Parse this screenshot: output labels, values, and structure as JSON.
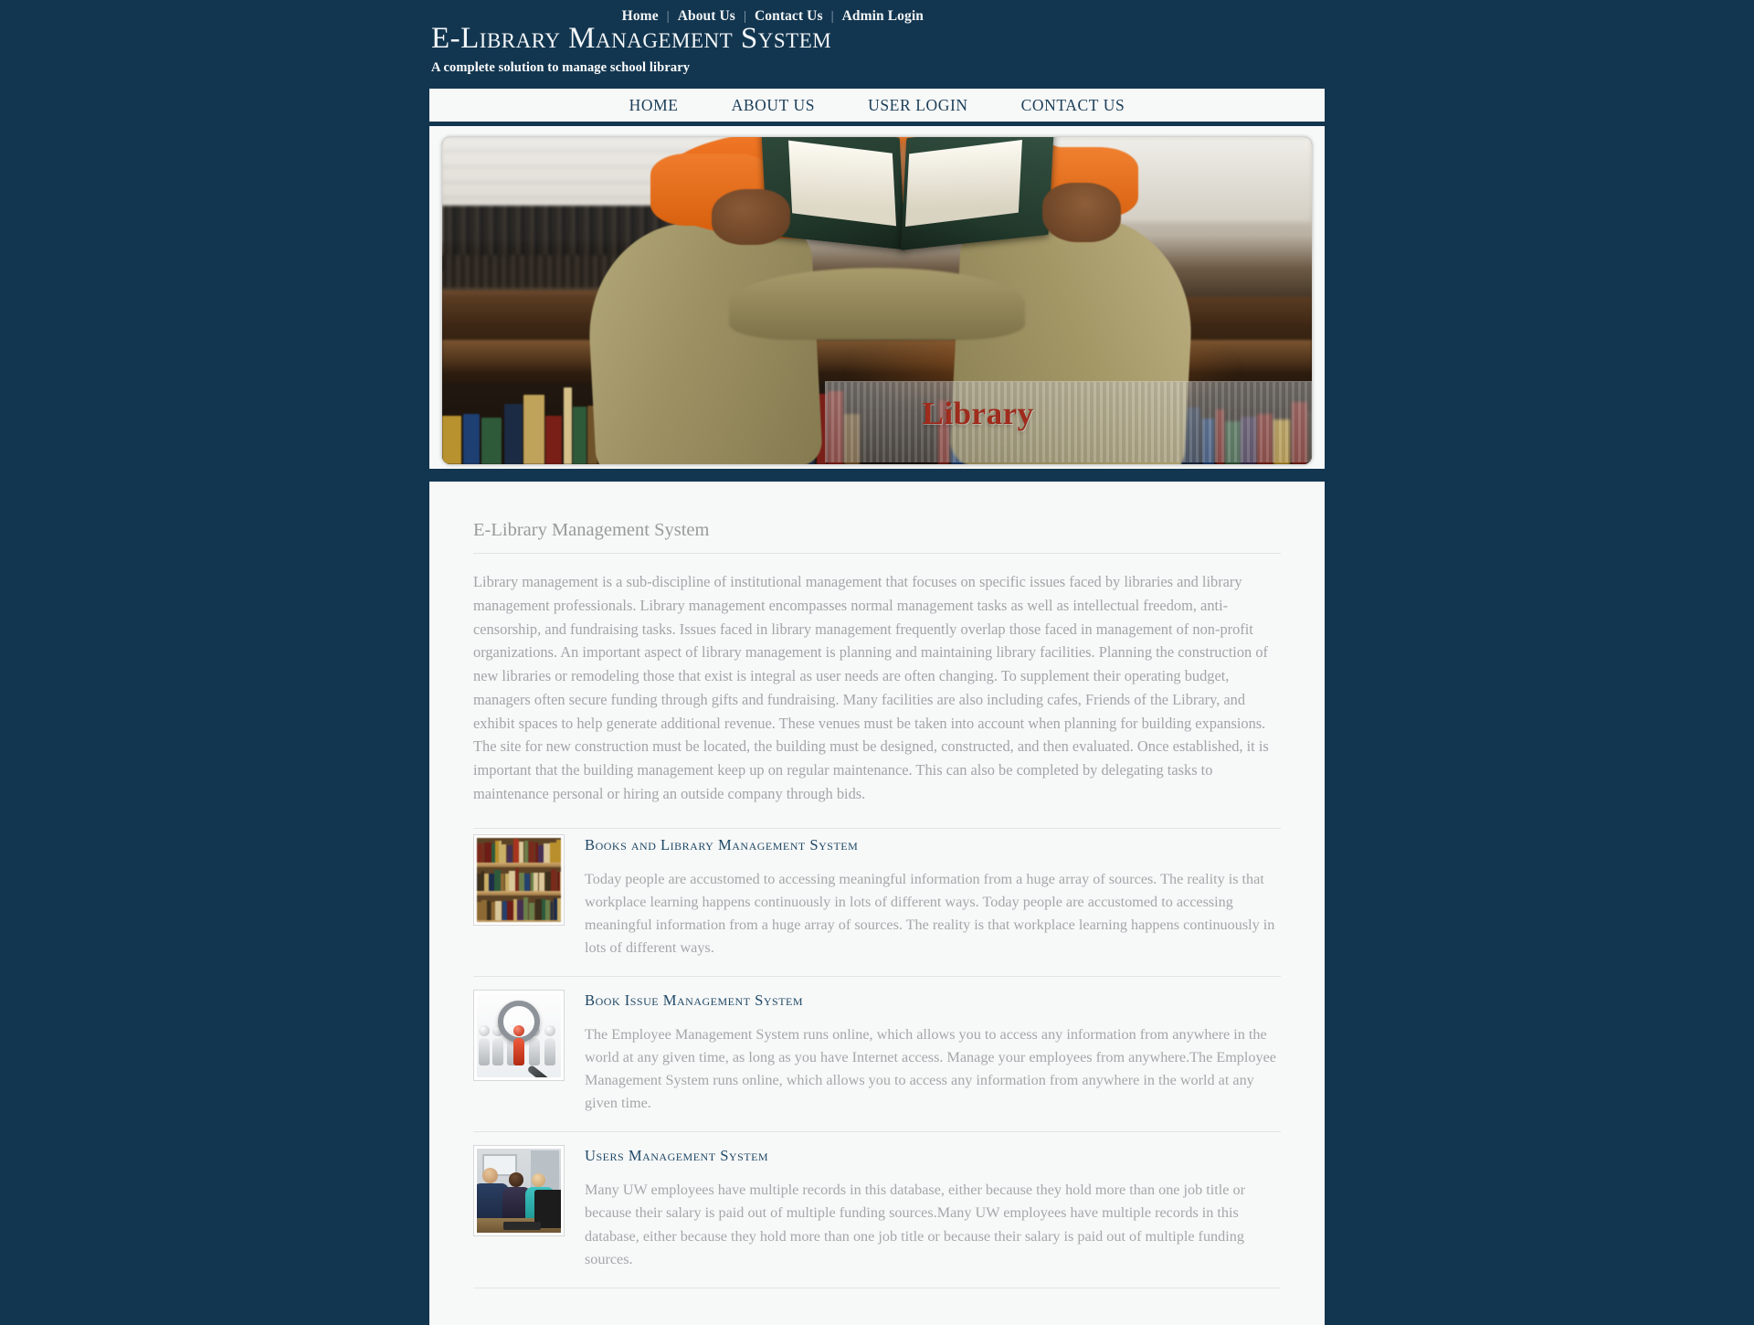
{
  "colors": {
    "page_bg": "#133650",
    "panel_bg": "#f7f8f8",
    "nav_link": "#1b3e58",
    "heading_blue": "#1e4866",
    "body_text": "#a4a8aa",
    "library_word": "#9e2b1c"
  },
  "top_nav": {
    "items": [
      {
        "label": "Home"
      },
      {
        "label": "About Us"
      },
      {
        "label": "Contact Us"
      },
      {
        "label": "Admin Login"
      }
    ],
    "separator": "|"
  },
  "brand": {
    "title": "E-Library Management System",
    "tagline": "A complete solution to manage school library"
  },
  "main_nav": {
    "items": [
      {
        "label": "HOME"
      },
      {
        "label": "ABOUT US"
      },
      {
        "label": "USER LOGIN"
      },
      {
        "label": "CONTACT US"
      }
    ]
  },
  "banner": {
    "alt": "Person in orange shirt reading a green hardcover book while seated above a library bookshelf",
    "overlay_word": "Library"
  },
  "content": {
    "section_title": "E-Library Management System",
    "intro": "Library management is a sub-discipline of institutional management that focuses on specific issues faced by libraries and library management professionals. Library management encompasses normal management tasks as well as intellectual freedom, anti-censorship, and fundraising tasks. Issues faced in library management frequently overlap those faced in management of non-profit organizations. An important aspect of library management is planning and maintaining library facilities. Planning the construction of new libraries or remodeling those that exist is integral as user needs are often changing. To supplement their operating budget, managers often secure funding through gifts and fundraising. Many facilities are also including cafes, Friends of the Library, and exhibit spaces to help generate additional revenue. These venues must be taken into account when planning for building expansions. The site for new construction must be located, the building must be designed, constructed, and then evaluated. Once established, it is important that the building management keep up on regular maintenance. This can also be completed by delegating tasks to maintenance personal or hiring an outside company through bids.",
    "features": [
      {
        "title": "Books and Library Management System",
        "text": "Today people are accustomed to accessing meaningful information from a huge array of sources. The reality is that workplace learning happens continuously in lots of different ways. Today people are accustomed to accessing meaningful information from a huge array of sources. The reality is that workplace learning happens continuously in lots of different ways.",
        "thumb_alt": "bookshelf-thumbnail"
      },
      {
        "title": "Book Issue Management System",
        "text": "The Employee Management System runs online, which allows you to access any information from anywhere in the world at any given time, as long as you have Internet access. Manage your employees from anywhere.The Employee Management System runs online, which allows you to access any information from anywhere in the world at any given time.",
        "thumb_alt": "magnifying-glass-people-thumbnail"
      },
      {
        "title": "Users Management System",
        "text": "Many UW employees have multiple records in this database, either because they hold more than one job title or because their salary is paid out of multiple funding sources.Many UW employees have multiple records in this database, either because they hold more than one job title or because their salary is paid out of multiple funding sources.",
        "thumb_alt": "people-at-computer-thumbnail"
      }
    ]
  }
}
